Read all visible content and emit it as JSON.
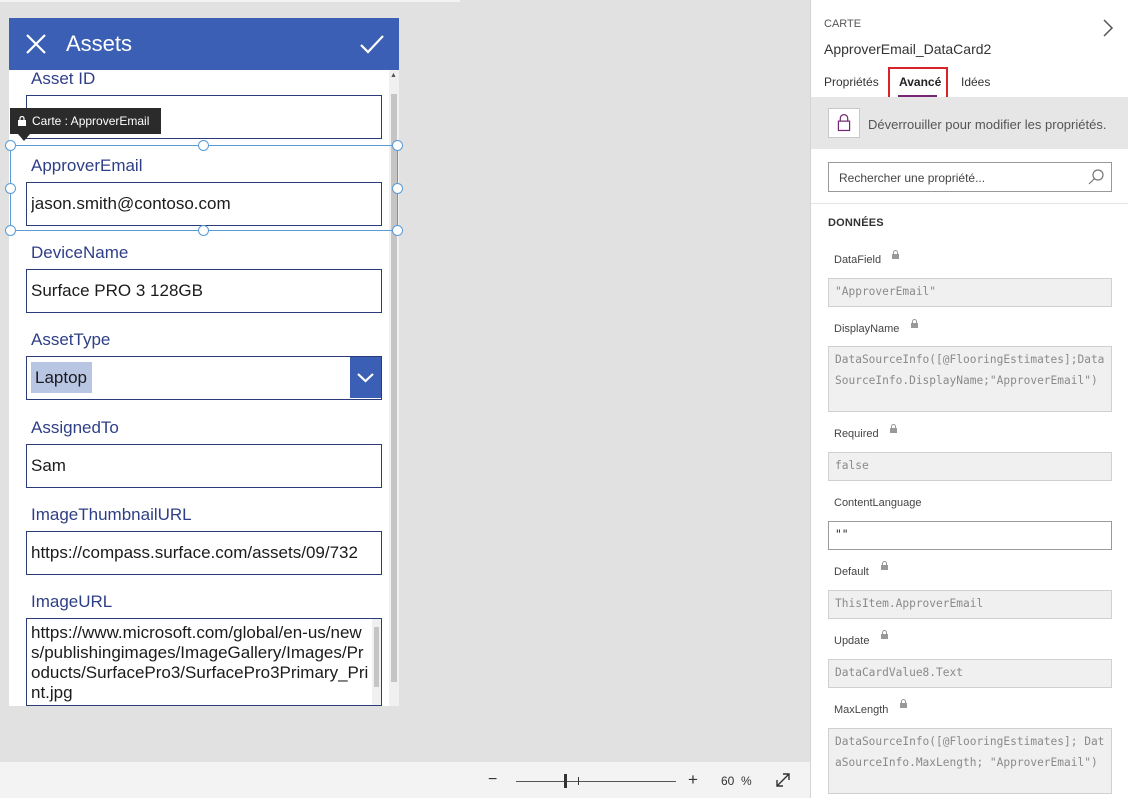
{
  "app": {
    "title": "Assets",
    "fields": [
      {
        "label": "Asset ID",
        "value": ""
      },
      {
        "label": "ApproverEmail",
        "value": "jason.smith@contoso.com"
      },
      {
        "label": "DeviceName",
        "value": "Surface PRO 3 128GB"
      },
      {
        "label": "AssetType",
        "value": "Laptop"
      },
      {
        "label": "AssignedTo",
        "value": "Sam"
      },
      {
        "label": "ImageThumbnailURL",
        "value": "https://compass.surface.com/assets/09/732"
      },
      {
        "label": "ImageURL",
        "value": "https://www.microsoft.com/global/en-us/news/publishingimages/ImageGallery/Images/Products/SurfacePro3/SurfacePro3Primary_Print.jpg"
      }
    ],
    "tooltip": "Carte : ApproverEmail"
  },
  "zoom": {
    "minus": "−",
    "plus": "+",
    "level": "60  %",
    "value_percent": 60
  },
  "panel": {
    "kind": "CARTE",
    "name": "ApproverEmail_DataCard2",
    "tabs": [
      "Propriétés",
      "Avancé",
      "Idées"
    ],
    "active_tab": "Avancé",
    "unlock_text": "Déverrouiller pour modifier les propriétés.",
    "search_placeholder": "Rechercher une propriété...",
    "section": "DONNÉES",
    "properties": [
      {
        "name": "DataField",
        "locked": true,
        "value": "\"ApproverEmail\""
      },
      {
        "name": "DisplayName",
        "locked": true,
        "value": "DataSourceInfo([@FlooringEstimates];DataSourceInfo.DisplayName;\"ApproverEmail\")"
      },
      {
        "name": "Required",
        "locked": true,
        "value": "false"
      },
      {
        "name": "ContentLanguage",
        "locked": false,
        "value": "\"\""
      },
      {
        "name": "Default",
        "locked": true,
        "value": "ThisItem.ApproverEmail"
      },
      {
        "name": "Update",
        "locked": true,
        "value": "DataCardValue8.Text"
      },
      {
        "name": "MaxLength",
        "locked": true,
        "value": "DataSourceInfo([@FlooringEstimates]; DataSourceInfo.MaxLength; \"ApproverEmail\")"
      }
    ]
  },
  "colors": {
    "header_blue": "#3b5fb5",
    "label_blue": "#2f3f87",
    "selection": "#5a9bd5",
    "tab_accent": "#742774",
    "highlight_red": "#d8232a"
  }
}
